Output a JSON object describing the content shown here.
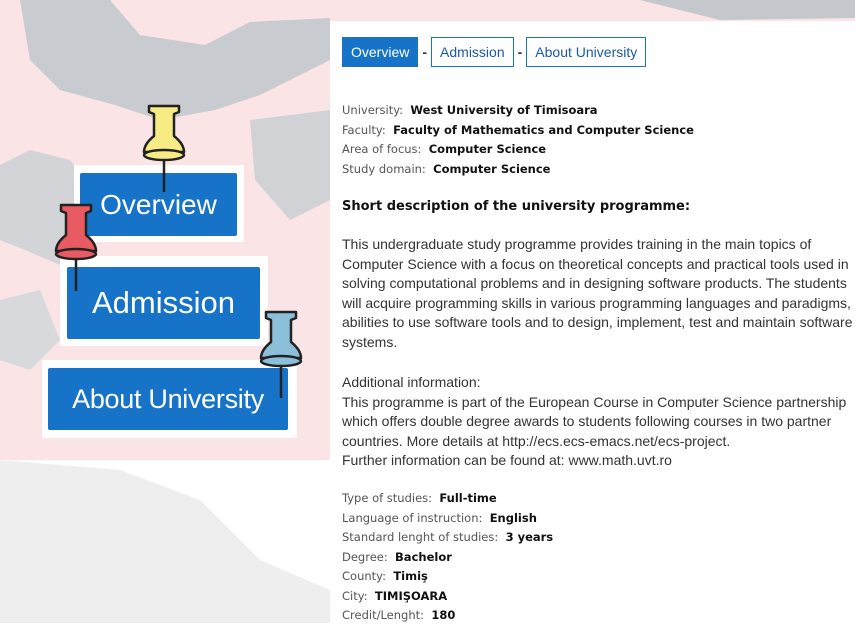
{
  "menu": {
    "overview_label": "Overview",
    "admission_label": "Admission",
    "about_label": "About University"
  },
  "tabs": [
    {
      "label": "Overview",
      "active": true
    },
    {
      "label": "Admission",
      "active": false
    },
    {
      "label": "About University",
      "active": false
    }
  ],
  "tab_separator": "-",
  "info_top": [
    {
      "label": "University:",
      "value": "West University of Timisoara"
    },
    {
      "label": "Faculty:",
      "value": "Faculty of Mathematics and Computer Science"
    },
    {
      "label": "Area of focus:",
      "value": "Computer Science"
    },
    {
      "label": "Study domain:",
      "value": "Computer Science"
    }
  ],
  "description_title": "Short description of the university programme:",
  "description_lines": [
    "This undergraduate study programme provides training in the main topics of",
    "Computer Science with a focus on theoretical concepts and practical tools used in",
    "solving computational problems and in designing software products. The students",
    "will acquire programming skills in various programming languages and paradigms,",
    "abilities to use software tools and to design, implement, test and maintain software",
    "systems."
  ],
  "additional_lines": [
    "Additional information:",
    "This programme is part of the European Course in Computer Science partnership",
    "which offers double degree awards to students following courses in two partner",
    "countries. More details at http://ecs.ecs-emacs.net/ecs-project.",
    "Further information can be found at: www.math.uvt.ro"
  ],
  "info_bottom": [
    {
      "label": "Type of studies:",
      "value": "Full-time"
    },
    {
      "label": "Language of instruction:",
      "value": "English"
    },
    {
      "label": "Standard lenght of studies:",
      "value": "3 years"
    },
    {
      "label": "Degree:",
      "value": "Bachelor"
    },
    {
      "label": "County:",
      "value": "Timiş"
    },
    {
      "label": "City:",
      "value": "TIMIŞOARA"
    },
    {
      "label": "Credit/Lenght:",
      "value": "180"
    }
  ],
  "colors": {
    "button_blue": "#1673c8",
    "pin_yellow": "#f7ec84",
    "pin_red": "#e85b63",
    "pin_blue": "#8bbfda",
    "background_pink": "#fbe4e6"
  },
  "icons": [
    "push-pin-icon"
  ]
}
